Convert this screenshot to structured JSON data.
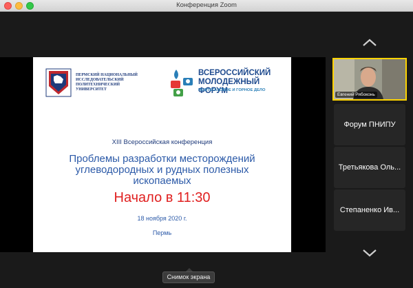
{
  "window": {
    "title": "Конференция Zoom"
  },
  "slide": {
    "pnipu_name": "Пермский национальный исследовательский политехнический университет",
    "pnipu_logo_label": "ПНИПУ",
    "forum_title_line1": "ВСЕРОССИЙСКИЙ",
    "forum_title_line2": "МОЛОДЕЖНЫЙ ФОРУМ",
    "forum_subtitle": "НЕФТЕГАЗОВОЕ И ГОРНОЕ ДЕЛО",
    "conference": "XIII  Всероссийская конференция",
    "title_line1": "Проблемы разработки месторождений",
    "title_line2": "углеводородных и рудных полезных",
    "title_line3": "ископаемых",
    "start_time": "Начало в 11:30",
    "date": "18 ноября 2020 г.",
    "city": "Пермь"
  },
  "participants": [
    {
      "name": "Евгений Рябоконь",
      "has_video": true
    },
    {
      "name": "Форум ПНИПУ",
      "has_video": false
    },
    {
      "name": "Третьякова Оль...",
      "has_video": false
    },
    {
      "name": "Степаненко Ив...",
      "has_video": false
    }
  ],
  "tooltip": "Снимок экрана",
  "icons": {
    "scroll_up": "chevron-up-icon",
    "scroll_down": "chevron-down-icon",
    "pnipu": "pnipu-logo",
    "forum": "forum-logo"
  },
  "colors": {
    "active_speaker": "#ffd400",
    "start_time": "#e02020",
    "title_blue": "#2c5aa8"
  }
}
